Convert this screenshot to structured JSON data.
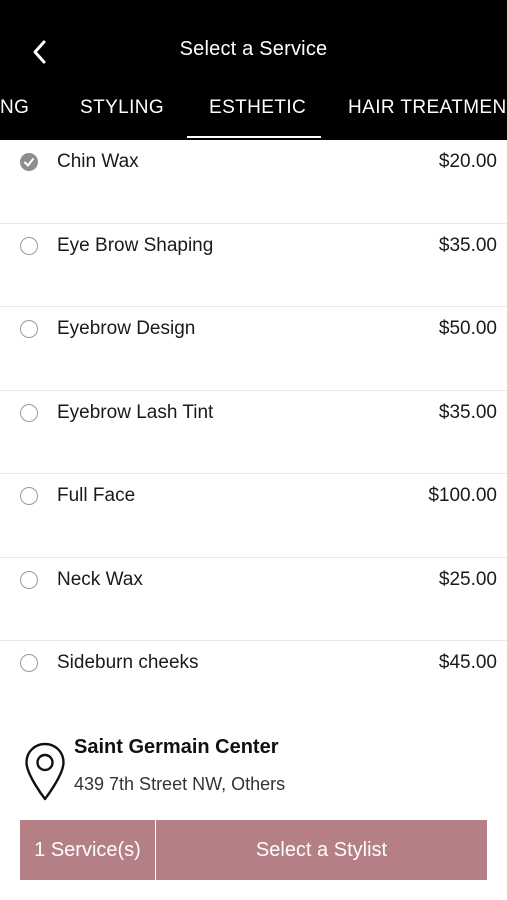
{
  "header": {
    "title": "Select a Service",
    "back_icon": "chevron-left-icon"
  },
  "tabs": [
    {
      "label": "NG",
      "active": false
    },
    {
      "label": "STYLING",
      "active": false
    },
    {
      "label": "ESTHETIC",
      "active": true
    },
    {
      "label": "HAIR TREATMENT",
      "active": false
    }
  ],
  "services": [
    {
      "name": "Chin Wax",
      "price": "$20.00",
      "selected": true
    },
    {
      "name": "Eye Brow Shaping",
      "price": "$35.00",
      "selected": false
    },
    {
      "name": "Eyebrow Design",
      "price": "$50.00",
      "selected": false
    },
    {
      "name": "Eyebrow Lash Tint",
      "price": "$35.00",
      "selected": false
    },
    {
      "name": "Full Face",
      "price": "$100.00",
      "selected": false
    },
    {
      "name": "Neck Wax",
      "price": "$25.00",
      "selected": false
    },
    {
      "name": "Sideburn cheeks",
      "price": "$45.00",
      "selected": false
    }
  ],
  "location": {
    "name": "Saint Germain Center",
    "address": "439 7th Street NW, Others",
    "icon": "map-pin-icon"
  },
  "footer": {
    "services_count_label": "1 Service(s)",
    "select_stylist_label": "Select a Stylist"
  },
  "colors": {
    "header_bg": "#000000",
    "accent": "#b47f85",
    "checked_radio": "#8e8e8e"
  }
}
